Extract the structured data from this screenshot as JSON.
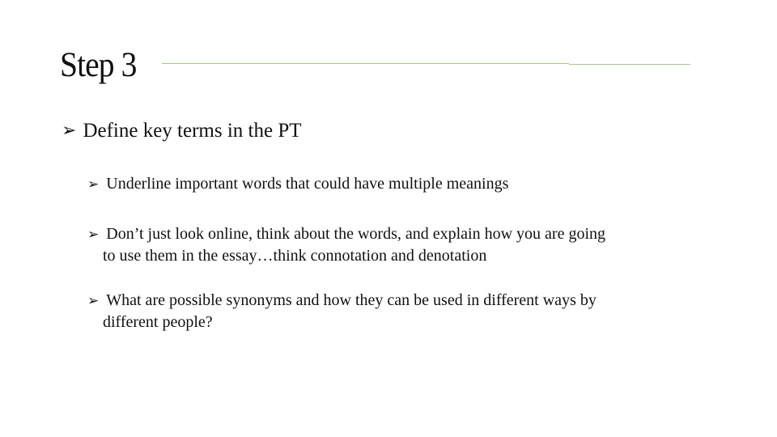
{
  "slide": {
    "title": "Step 3",
    "accent_color": "#a9c48a",
    "bullet_glyph": "➢",
    "main_bullet": "Define key terms in the PT",
    "sub_bullets": [
      {
        "line1": "Underline important words that could have multiple meanings",
        "line2": ""
      },
      {
        "line1": "Don’t just look online, think about the words, and explain how you are going",
        "line2": "to use them in the essay…think connotation and denotation"
      },
      {
        "line1": "What are possible synonyms and how they can be used in different ways by",
        "line2": "different people?"
      }
    ]
  }
}
